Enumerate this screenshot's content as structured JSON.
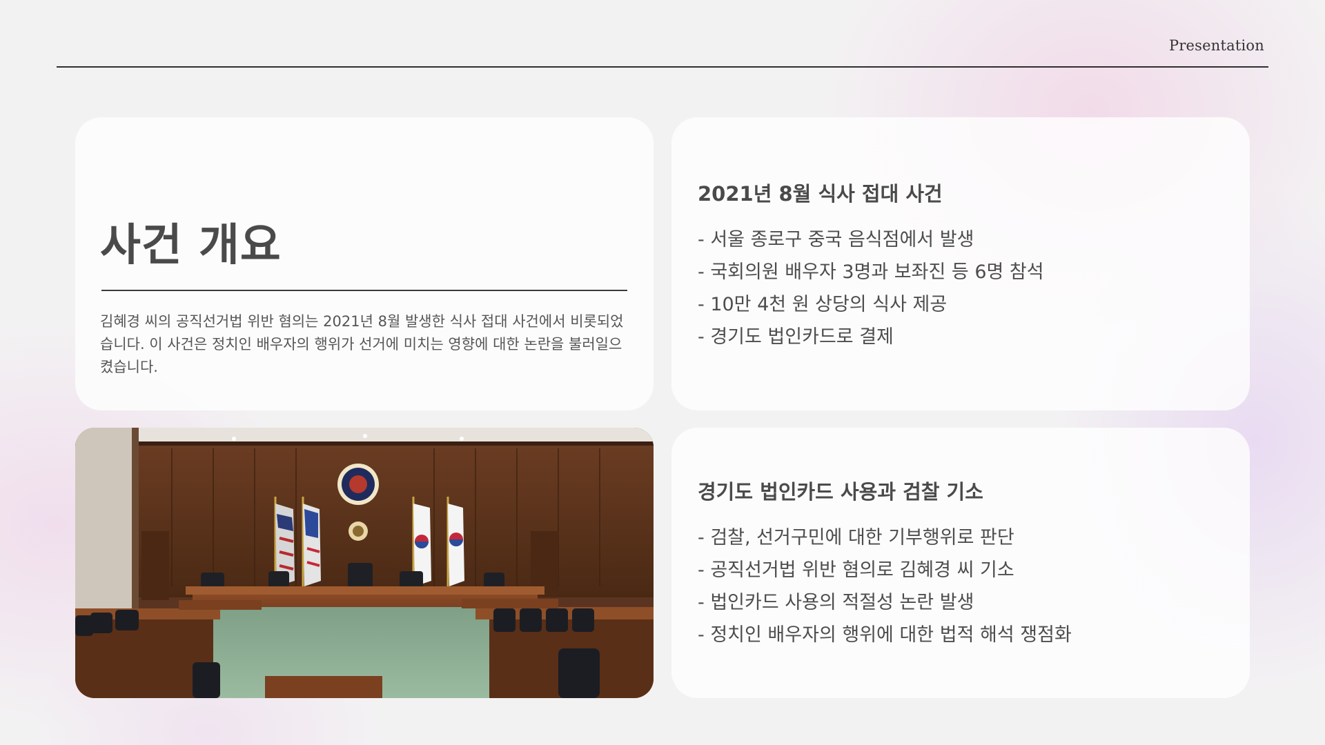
{
  "header": {
    "label": "Presentation"
  },
  "overview": {
    "title": "사건 개요",
    "text": "김혜경 씨의 공직선거법 위반 혐의는 2021년 8월 발생한 식사 접대 사건에서 비롯되었습니다. 이 사건은 정치인 배우자의 행위가 선거에 미치는 영향에 대한 논란을 불러일으켰습니다."
  },
  "event": {
    "title": "2021년 8월 식사 접대 사건",
    "bullets": [
      "- 서울 종로구 중국 음식점에서 발생",
      "- 국회의원 배우자 3명과 보좌진 등 6명 참석",
      "- 10만 4천 원 상당의 식사 제공",
      "- 경기도 법인카드로 결제"
    ]
  },
  "charge": {
    "title": "경기도 법인카드 사용과 검찰 기소",
    "bullets": [
      "- 검찰, 선거구민에 대한 기부행위로 판단",
      "- 공직선거법 위반 혐의로 김혜경 씨 기소",
      "- 법인카드 사용의 적절성 논란 발생",
      "- 정치인 배우자의 행위에 대한 법적 해석 쟁점화"
    ]
  },
  "photo": {
    "subject": "courtroom-photo"
  },
  "colors": {
    "background": "#f3f2f3",
    "card": "#ffffff",
    "text": "#4a4a4a",
    "wood": "#5a3420",
    "carpet": "#8fae95"
  }
}
